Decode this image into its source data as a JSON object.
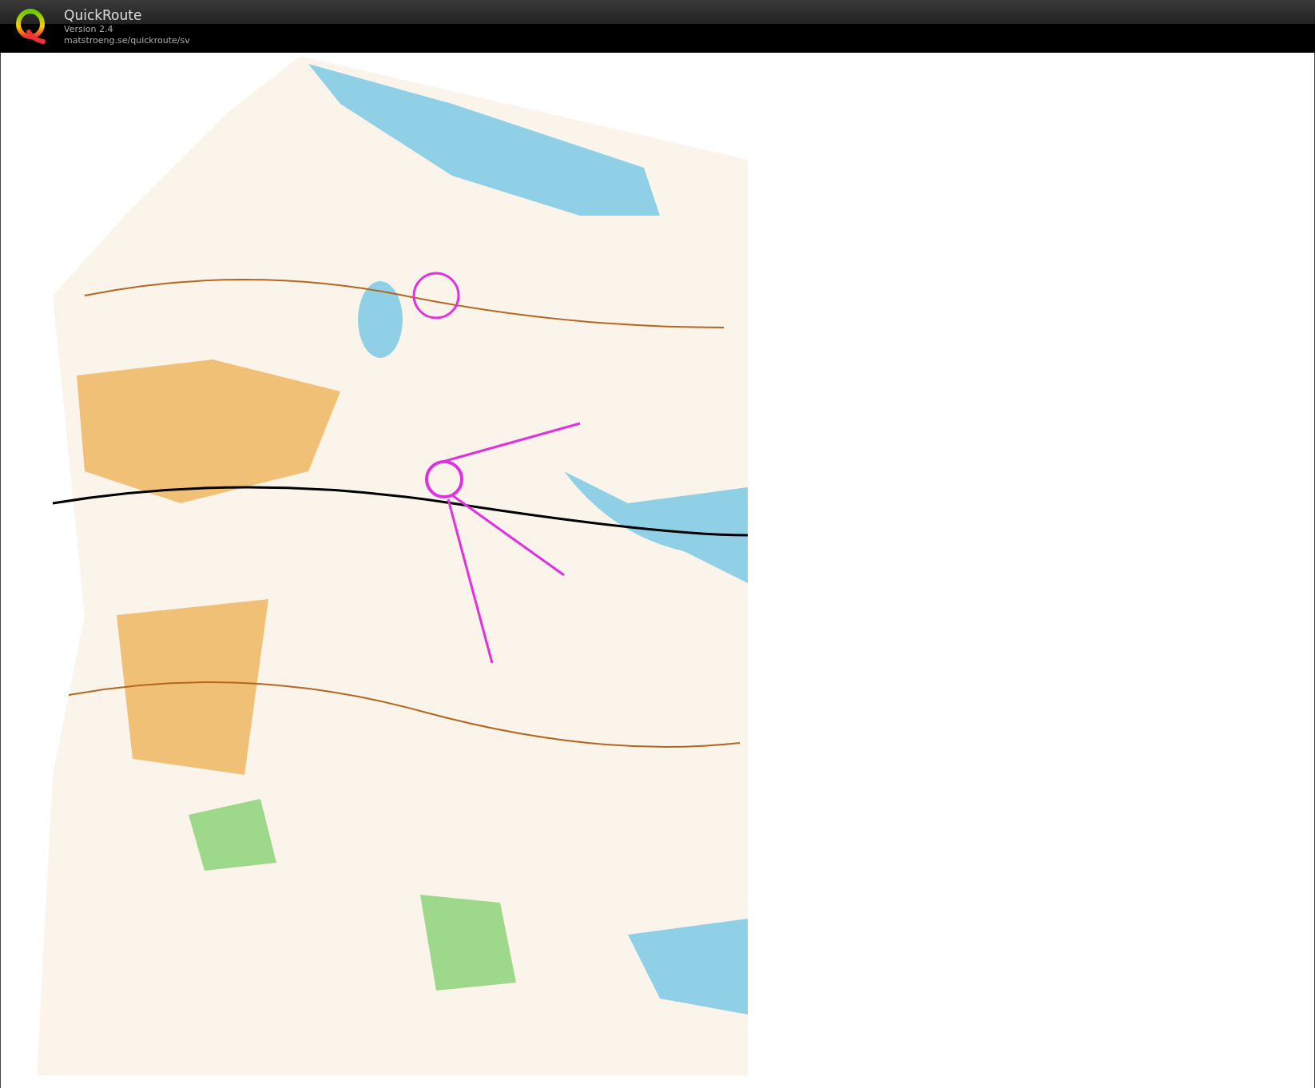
{
  "header": {
    "title": "QuickRoute",
    "version": "Version 2.4",
    "url": "matstroeng.se/quickroute/sv"
  }
}
